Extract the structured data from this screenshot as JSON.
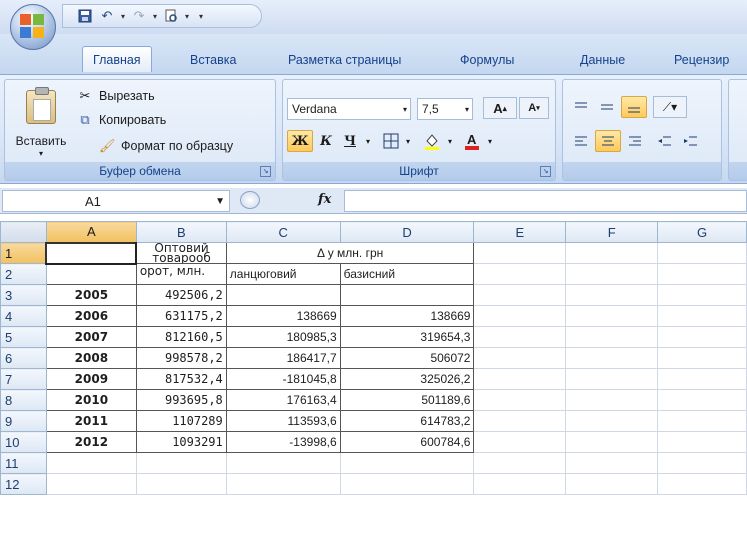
{
  "qat": {
    "save_icon": "save-icon",
    "undo_icon": "undo-icon",
    "redo_icon": "redo-icon",
    "preview_icon": "print-preview-icon"
  },
  "tabs": [
    {
      "label": "Главная",
      "active": true
    },
    {
      "label": "Вставка"
    },
    {
      "label": "Разметка страницы"
    },
    {
      "label": "Формулы"
    },
    {
      "label": "Данные"
    },
    {
      "label": "Рецензир"
    }
  ],
  "clipboard": {
    "paste": "Вставить",
    "cut": "Вырезать",
    "copy": "Копировать",
    "format_painter": "Формат по образцу",
    "group_label": "Буфер обмена"
  },
  "font": {
    "family": "Verdana",
    "size": "7,5",
    "bold": "Ж",
    "italic": "К",
    "underline": "Ч",
    "grow_label": "A",
    "shrink_label": "A",
    "group_label": "Шрифт"
  },
  "formula_bar": {
    "name_box": "A1",
    "fx": "fx",
    "value": ""
  },
  "sheet": {
    "columns": [
      "A",
      "B",
      "C",
      "D",
      "E",
      "F",
      "G"
    ],
    "header_b1": "Оптовий товарооб",
    "header_b2": "орот, млн.",
    "header_cd1": "Δ у млн. грн",
    "header_c2": "ланцюговий",
    "header_d2": "базисний",
    "rows": [
      {
        "n": "3",
        "year": "2005",
        "b": "492506,2",
        "c": "",
        "d": ""
      },
      {
        "n": "4",
        "year": "2006",
        "b": "631175,2",
        "c": "138669",
        "d": "138669"
      },
      {
        "n": "5",
        "year": "2007",
        "b": "812160,5",
        "c": "180985,3",
        "d": "319654,3"
      },
      {
        "n": "6",
        "year": "2008",
        "b": "998578,2",
        "c": "186417,7",
        "d": "506072"
      },
      {
        "n": "7",
        "year": "2009",
        "b": "817532,4",
        "c": "-181045,8",
        "d": "325026,2"
      },
      {
        "n": "8",
        "year": "2010",
        "b": "993695,8",
        "c": "176163,4",
        "d": "501189,6"
      },
      {
        "n": "9",
        "year": "2011",
        "b": "1107289",
        "c": "113593,6",
        "d": "614783,2"
      },
      {
        "n": "10",
        "year": "2012",
        "b": "1093291",
        "c": "-13998,6",
        "d": "600784,6"
      }
    ],
    "row_numbers_top": [
      "1",
      "2"
    ],
    "row_numbers_bottom": [
      "11",
      "12"
    ]
  }
}
